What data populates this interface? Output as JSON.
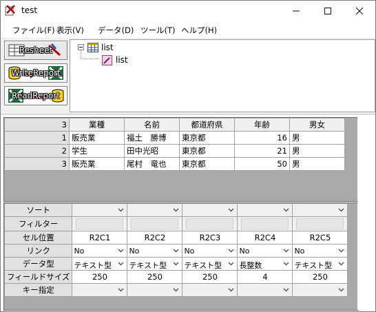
{
  "window": {
    "title": "test"
  },
  "menu": [
    "ファイル(F)",
    "表示(V)",
    "データ(D)",
    "ツール(T)",
    "ヘルプ(H)"
  ],
  "toolbar": {
    "buttons": [
      "Resheet",
      "WriteReport",
      "ReadReport"
    ]
  },
  "tree": {
    "root": "list",
    "child": "list"
  },
  "grid": {
    "row_count": "3",
    "headers": [
      "業種",
      "名前",
      "都道府県",
      "年齢",
      "男女"
    ],
    "rows": [
      {
        "num": "1",
        "cells": [
          "販売業",
          "福土　勝博",
          "東京都",
          "16",
          "男"
        ]
      },
      {
        "num": "2",
        "cells": [
          "学生",
          "田中光昭",
          "東京都",
          "21",
          "男"
        ]
      },
      {
        "num": "3",
        "cells": [
          "販売業",
          "尾村　竜也",
          "東京都",
          "50",
          "男"
        ]
      }
    ]
  },
  "settings": {
    "labels": [
      "ソート",
      "フィルター",
      "セル位置",
      "リンク",
      "データ型",
      "フィールドサイズ",
      "キー指定"
    ],
    "positions": [
      "R2C1",
      "R2C2",
      "R2C3",
      "R2C4",
      "R2C5"
    ],
    "links": [
      "No",
      "No",
      "No",
      "No",
      "No"
    ],
    "types": [
      "テキスト型",
      "テキスト型",
      "テキスト型",
      "長整数",
      "テキスト型"
    ],
    "sizes": [
      "250",
      "250",
      "250",
      "4",
      "250"
    ]
  }
}
